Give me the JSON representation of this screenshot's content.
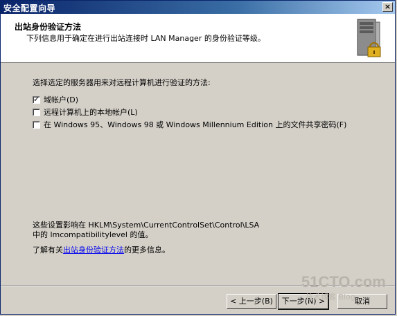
{
  "window": {
    "title": "安全配置向导"
  },
  "header": {
    "title": "出站身份验证方法",
    "subtitle": "下列信息用于确定在进行出站连接时 LAN Manager 的身份验证等级。"
  },
  "content": {
    "prompt": "选择选定的服务器用来对远程计算机进行验证的方法:",
    "options": [
      {
        "label": "域帐户(D)",
        "checked": true
      },
      {
        "label": "远程计算机上的本地帐户(L)",
        "checked": false
      },
      {
        "label": "在 Windows 95、Windows 98 或 Windows Millennium Edition 上的文件共享密码(F)",
        "checked": false
      }
    ],
    "info_line1": "这些设置影响在 HKLM\\System\\CurrentControlSet\\Control\\LSA",
    "info_line2": "中的 lmcompatibilitylevel 的值。",
    "more_prefix": "了解有关",
    "more_link": "出站身份验证方法",
    "more_suffix": "的更多信息。"
  },
  "buttons": {
    "back": "< 上一步(B)",
    "next": "下一步(N) >",
    "cancel": "取消"
  },
  "watermark": {
    "logo": "51CTO.com",
    "text": "技术博客 Blog"
  }
}
